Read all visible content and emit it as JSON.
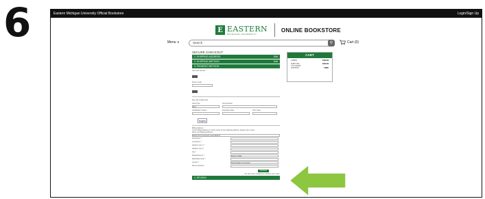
{
  "step_number": "6",
  "topbar": {
    "left": "Eastern Michigan University Official Bookstore",
    "right": "Login/Sign Up"
  },
  "logo": {
    "mark": "E",
    "title": "EASTERN",
    "subtitle": "MICHIGAN UNIVERSITY",
    "store": "ONLINE BOOKSTORE"
  },
  "nav": {
    "menu": "Menu ∨",
    "search_placeholder": "Search",
    "cart": "Cart (0)"
  },
  "checkout": {
    "title": "SECURE CHECKOUT",
    "steps": [
      {
        "label": "1. SHIPPING ADDRESS",
        "tag": "Edit"
      },
      {
        "label": "2. SHIPPING METHOD",
        "tag": "Edit"
      },
      {
        "label": "3. PAYMENT METHOD",
        "tag": ""
      }
    ],
    "gift_card_label": "Gift Card Number",
    "promo_label": "Promo Code",
    "pay_credit": "Pay with Credit Card",
    "card_type": "Card Type",
    "card_number": "Card Number",
    "card_type_value": "Visa",
    "name_on_card": "Cardholder's Name",
    "expiration": "Expiration Date",
    "cvv": "CVV Code",
    "paypal": "PayPal",
    "billing_title": "Billing Address",
    "billing_note": "If your billing address is not the same as the shipping address, please enter it here.",
    "same_as_shipping": "Same as Shipping Address",
    "select_address": "Select from previously used address",
    "fields": [
      "First Name *",
      "Last Name *",
      "Address Line 1 *",
      "Address Line 2",
      "City *",
      "State/Province *",
      "Zip/Postal Code *",
      "Country *",
      "Phone Number *"
    ],
    "state_value": "Select a State",
    "country_value": "United States of America",
    "continue_btn": "Continue",
    "terms_note": "You will not be charged yet. Review your order.",
    "review_step": "4. REVIEW"
  },
  "cart": {
    "title": "CART",
    "rows": [
      {
        "label": "LAB999",
        "value": "$163.99"
      },
      {
        "label": "SUBTOTAL",
        "value": "$163.99"
      },
      {
        "label": "YOU SAVED",
        "value": ""
      },
      {
        "label": "SHIPPING",
        "value": "FREE"
      }
    ]
  },
  "colors": {
    "accent": "#1f7a3a",
    "arrow": "#8dc63f"
  }
}
